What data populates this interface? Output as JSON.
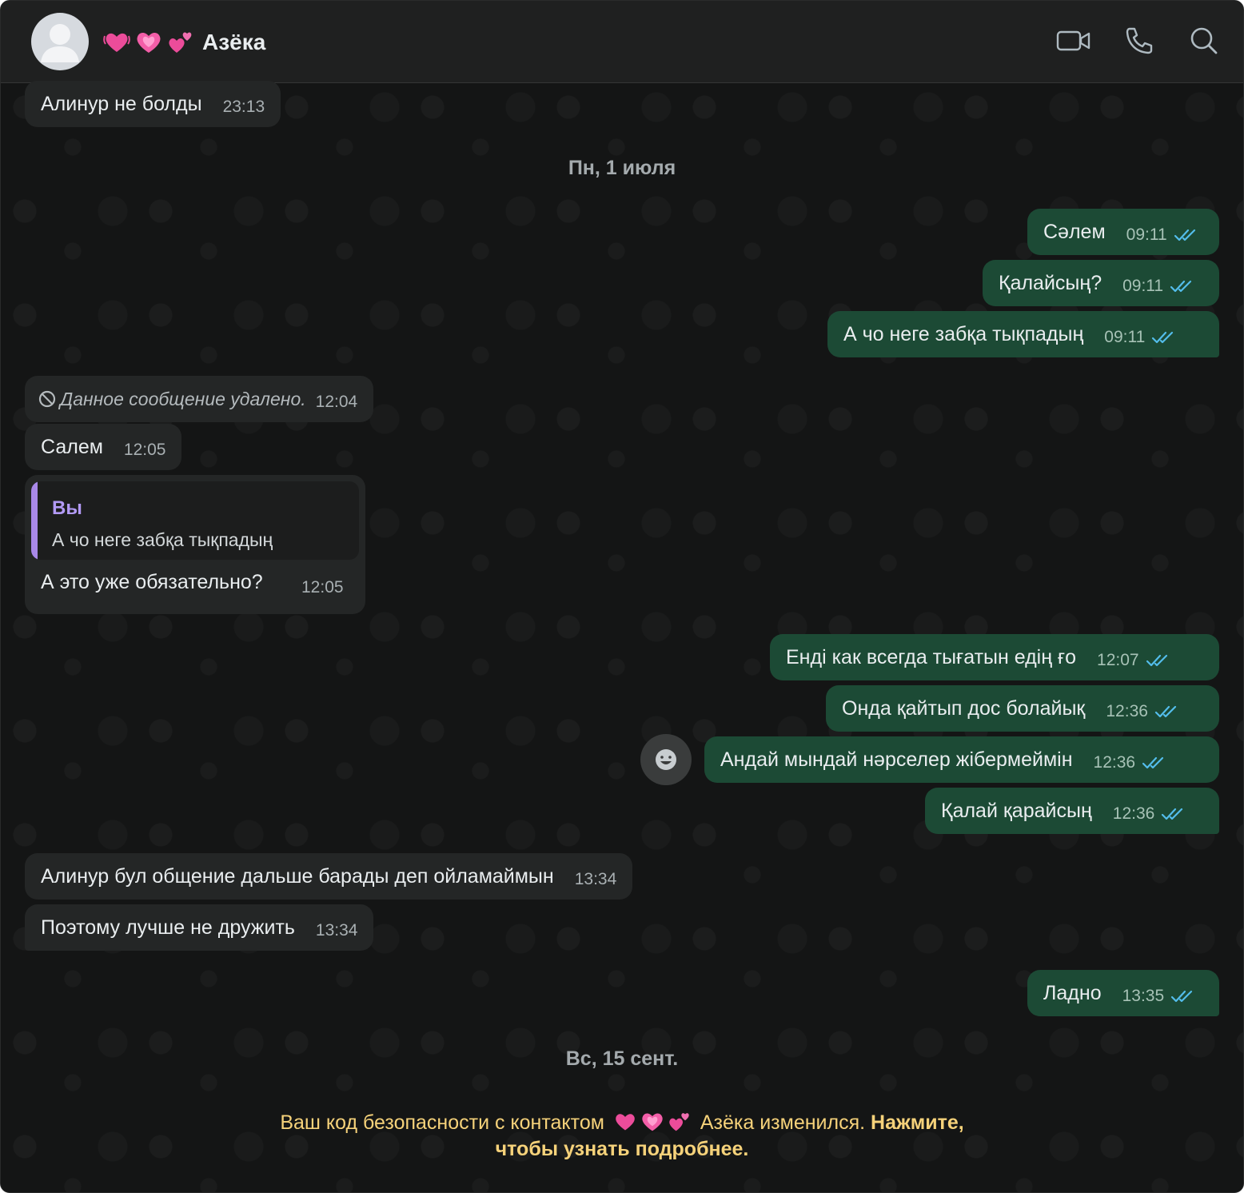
{
  "header": {
    "contact_name": "Азёка",
    "hearts": [
      "💓",
      "💗",
      "💕"
    ],
    "icons": [
      "video-call-icon",
      "voice-call-icon",
      "search-icon"
    ]
  },
  "dates": {
    "first": "Пн, 1 июля",
    "second": "Вс, 15 сент."
  },
  "messages": [
    {
      "dir": "in",
      "text": "Алинур не болды",
      "time": "23:13"
    },
    {
      "dir": "out",
      "text": "Сәлем",
      "time": "09:11",
      "status": "read"
    },
    {
      "dir": "out",
      "text": "Қалайсың?",
      "time": "09:11",
      "status": "read"
    },
    {
      "dir": "out",
      "text": "А чо неге забқа тықпадың",
      "time": "09:11",
      "status": "read"
    },
    {
      "dir": "in",
      "text": "Данное сообщение удалено.",
      "time": "12:04",
      "deleted": true
    },
    {
      "dir": "in",
      "text": "Салем",
      "time": "12:05"
    },
    {
      "dir": "in",
      "text": "А это уже обязательно?",
      "time": "12:05",
      "reply_to": {
        "author": "Вы",
        "text": "А чо неге забқа тықпадың"
      }
    },
    {
      "dir": "out",
      "text": "Енді как всегда тығатын едің ғо",
      "time": "12:07",
      "status": "read"
    },
    {
      "dir": "out",
      "text": "Онда қайтып дос болайық",
      "time": "12:36",
      "status": "read"
    },
    {
      "dir": "out",
      "text": "Андай мындай нәрселер жібермеймін",
      "time": "12:36",
      "status": "read"
    },
    {
      "dir": "out",
      "text": "Қалай қарайсың",
      "time": "12:36",
      "status": "read"
    },
    {
      "dir": "in",
      "text": "Алинур бул общение дальше барады деп ойламаймын",
      "time": "13:34"
    },
    {
      "dir": "in",
      "text": "Поэтому лучше не дружить",
      "time": "13:34"
    },
    {
      "dir": "out",
      "text": "Ладно",
      "time": "13:35",
      "status": "read"
    }
  ],
  "notice": {
    "prefix": "Ваш код безопасности с контактом",
    "name": "Азёка изменился.",
    "action_line1": "Нажмите,",
    "action_line2": "чтобы узнать подробнее."
  },
  "colors": {
    "incoming_bubble": "#242626",
    "outgoing_bubble": "#1c4a35",
    "read_ticks": "#53bdeb",
    "notice": "#f6d27a",
    "reply_accent": "#a988e8"
  }
}
